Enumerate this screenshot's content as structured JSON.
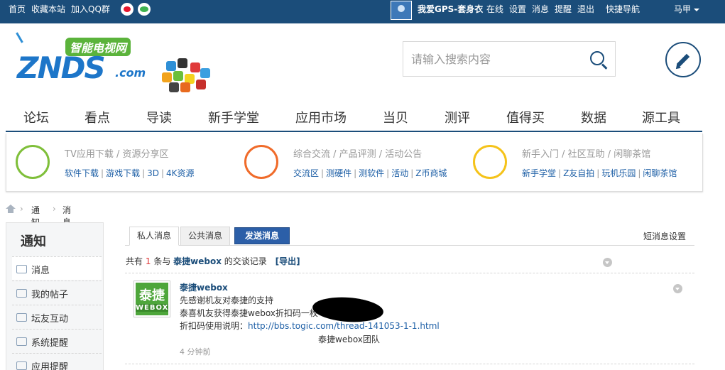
{
  "topbar": {
    "left_links": [
      "首页",
      "收藏本站",
      "加入QQ群"
    ],
    "username": "我爱GPS-套身衣",
    "right_links": [
      "在线",
      "设置",
      "消息",
      "提醒",
      "退出"
    ],
    "quick_nav": "快捷导航",
    "user_menu": "马甲"
  },
  "logo": {
    "subtitle": "智能电视网",
    "brand": "ZNDS",
    "domain": ".com"
  },
  "search": {
    "placeholder": "请输入搜索内容"
  },
  "nav": [
    "论坛",
    "看点",
    "导读",
    "新手学堂",
    "应用市场",
    "当贝",
    "测评",
    "值得买",
    "数据",
    "源工具"
  ],
  "categories": [
    {
      "title": "TV应用下载 / 资源分享区",
      "links": [
        "软件下载",
        "游戏下载",
        "3D",
        "4K资源"
      ],
      "color": "#7fbf3a"
    },
    {
      "title": "综合交流 / 产品评测 / 活动公告",
      "links": [
        "交流区",
        "测硬件",
        "测软件",
        "活动",
        "Z币商城"
      ],
      "color": "#f06b2a"
    },
    {
      "title": "新手入门 / 社区互助 / 闲聊茶馆",
      "links": [
        "新手学堂",
        "Z友自拍",
        "玩机乐园",
        "闲聊茶馆"
      ],
      "color": "#f5c31a"
    }
  ],
  "breadcrumb": [
    "通知",
    "消息"
  ],
  "sidebar": {
    "title": "通知",
    "items": [
      "消息",
      "我的帖子",
      "坛友互动",
      "系统提醒",
      "应用提醒"
    ]
  },
  "tabs": {
    "private": "私人消息",
    "public": "公共消息",
    "send": "发送消息",
    "settings": "短消息设置"
  },
  "summary": {
    "prefix": "共有",
    "count": "1",
    "middle": "条与",
    "user": "泰捷webox",
    "suffix": "的交谈记录",
    "export": "[导出]"
  },
  "message": {
    "avatar_top": "泰捷",
    "avatar_bottom": "WEBOX",
    "sender": "泰捷webox",
    "line1": "先感谢机友对泰捷的支持",
    "line2": "泰喜机友获得泰捷webox折扣码一枚",
    "line3_label": "折扣码使用说明：",
    "line3_link": "http://bbs.togic.com/thread-141053-1-1.html",
    "signature": "泰捷webox团队",
    "time": "4 分钟前"
  }
}
